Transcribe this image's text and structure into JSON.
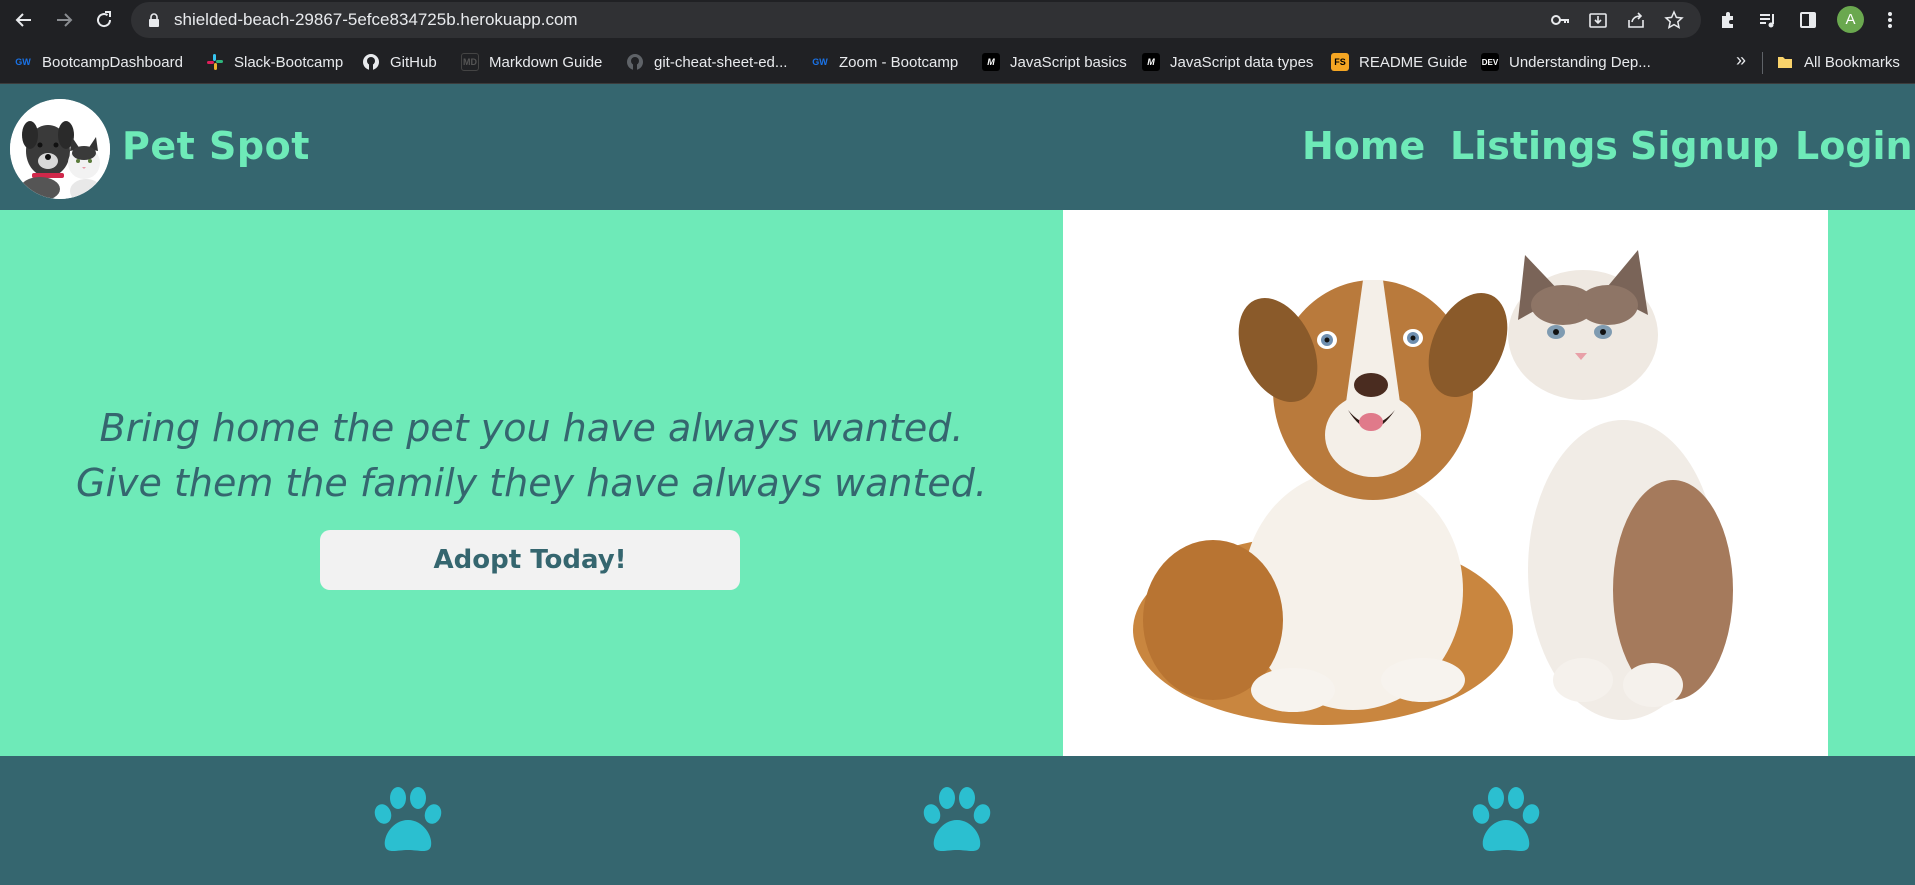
{
  "browser": {
    "url": "shielded-beach-29867-5efce834725b.herokuapp.com",
    "profile_initial": "A",
    "profile_color": "#6aa84f",
    "nav_icons": [
      "back-icon",
      "forward-icon",
      "reload-icon"
    ],
    "omnibox_icons": [
      "key-icon",
      "install-icon",
      "share-icon",
      "star-icon"
    ],
    "toolbar_icons": [
      "extensions-icon",
      "media-icon",
      "side-panel-icon",
      "menu-icon"
    ]
  },
  "bookmarks": {
    "items": [
      {
        "label": "BootcampDashboard",
        "icon": "gw-icon"
      },
      {
        "label": "Slack-Bootcamp",
        "icon": "slack-icon"
      },
      {
        "label": "GitHub",
        "icon": "github-icon"
      },
      {
        "label": "Markdown Guide",
        "icon": "markdown-icon"
      },
      {
        "label": "git-cheat-sheet-ed...",
        "icon": "github-icon"
      },
      {
        "label": "Zoom - Bootcamp",
        "icon": "gw-icon"
      },
      {
        "label": "JavaScript basics",
        "icon": "mdn-icon"
      },
      {
        "label": "JavaScript data types",
        "icon": "mdn-icon"
      },
      {
        "label": "README Guide",
        "icon": "fs-icon"
      },
      {
        "label": "Understanding Dep...",
        "icon": "dev-icon"
      }
    ],
    "more": "»",
    "all_bookmarks": "All Bookmarks"
  },
  "site": {
    "title": "Pet Spot",
    "nav": [
      "Home",
      "Listings",
      "Signup",
      "Login"
    ],
    "colors": {
      "header": "#35666f",
      "accent": "#6eeab8",
      "paw": "#2bbfd0"
    }
  },
  "hero": {
    "line1": "Bring home the pet you have always wanted.",
    "line2": "Give them the family they have always wanted.",
    "cta": "Adopt Today!"
  },
  "footer": {
    "icons": [
      "paw-icon",
      "paw-icon",
      "paw-icon"
    ]
  }
}
